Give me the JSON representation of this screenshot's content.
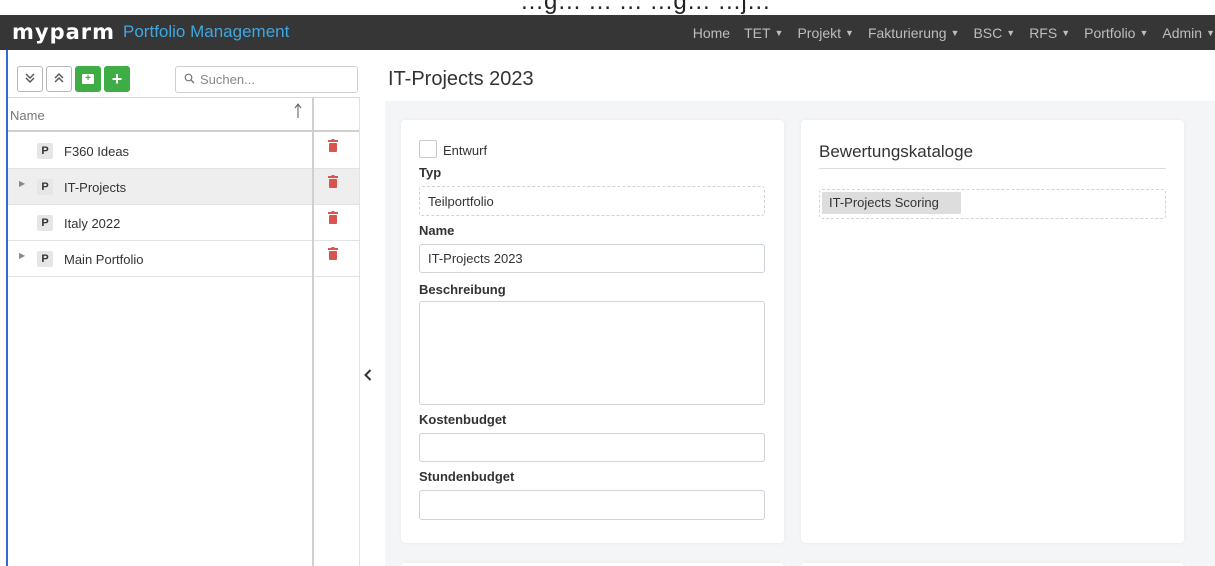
{
  "top_cut_text": "…g… … … …g… …j…",
  "brand": {
    "logo": "myparm",
    "app_name": "Portfolio Management",
    "app_color": "#3fa7e2"
  },
  "nav_menu": [
    {
      "label": "Home",
      "dropdown": false
    },
    {
      "label": "TET",
      "dropdown": true
    },
    {
      "label": "Projekt",
      "dropdown": true
    },
    {
      "label": "Fakturierung",
      "dropdown": true
    },
    {
      "label": "BSC",
      "dropdown": true
    },
    {
      "label": "RFS",
      "dropdown": true
    },
    {
      "label": "Portfolio",
      "dropdown": true
    },
    {
      "label": "Admin",
      "dropdown": true
    }
  ],
  "toolbar": {
    "expand_all_icon": "double-chevron-down-icon",
    "collapse_all_icon": "double-chevron-up-icon",
    "add_child_icon": "add-folder-icon",
    "add_icon": "plus-icon",
    "accent": "#3fad46"
  },
  "search": {
    "placeholder": "Suchen..."
  },
  "tree": {
    "header_name": "Name",
    "sort_icon": "sort-arrow-up-icon",
    "rows": [
      {
        "badge": "P",
        "label": "F360 Ideas",
        "expandable": false,
        "selected": false
      },
      {
        "badge": "P",
        "label": "IT-Projects",
        "expandable": true,
        "selected": true
      },
      {
        "badge": "P",
        "label": "Italy 2022",
        "expandable": false,
        "selected": false
      },
      {
        "badge": "P",
        "label": "Main Portfolio",
        "expandable": true,
        "selected": false
      }
    ],
    "delete_color": "#d9534f"
  },
  "page_title": "IT-Projects 2023",
  "form": {
    "draft_label": "Entwurf",
    "type_label": "Typ",
    "type_value": "Teilportfolio",
    "name_label": "Name",
    "name_value": "IT-Projects 2023",
    "description_label": "Beschreibung",
    "description_value": "",
    "cost_budget_label": "Kostenbudget",
    "cost_budget_value": "",
    "hours_budget_label": "Stundenbudget",
    "hours_budget_value": ""
  },
  "catalogs": {
    "title": "Bewertungskataloge",
    "items": [
      "IT-Projects Scoring"
    ]
  },
  "nav_bg": "#363636"
}
